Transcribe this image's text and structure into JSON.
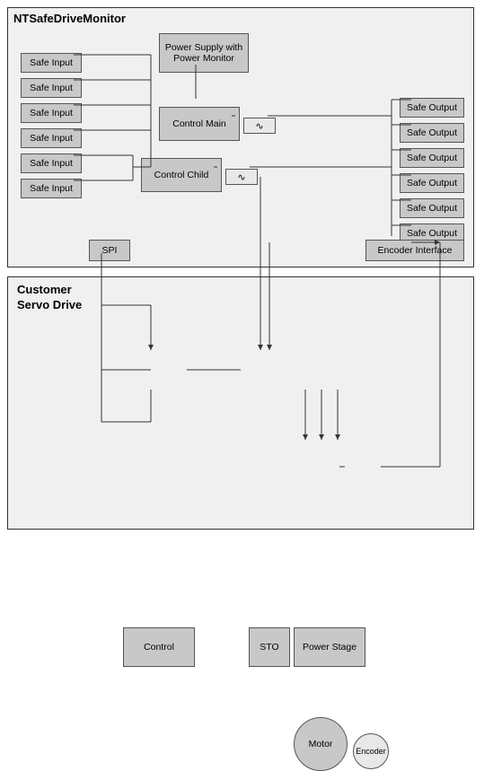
{
  "diagram": {
    "title_monitor": "NTSafeDriveMonitor",
    "title_customer": "Customer\nServo Drive",
    "safe_inputs": [
      "Safe Input",
      "Safe Input",
      "Safe Input",
      "Safe Input",
      "Safe Input",
      "Safe Input"
    ],
    "safe_outputs": [
      "Safe Output",
      "Safe Output",
      "Safe Output",
      "Safe Output",
      "Safe Output",
      "Safe Output"
    ],
    "power_supply": "Power Supply with\nPower Monitor",
    "control_main": "Control Main",
    "control_child": "Control Child",
    "spi": "SPI",
    "encoder_interface": "Encoder Interface",
    "control": "Control",
    "sto": "STO",
    "power_stage": "Power Stage",
    "motor": "Motor",
    "encoder": "Encoder",
    "wave_symbol": "∿"
  }
}
